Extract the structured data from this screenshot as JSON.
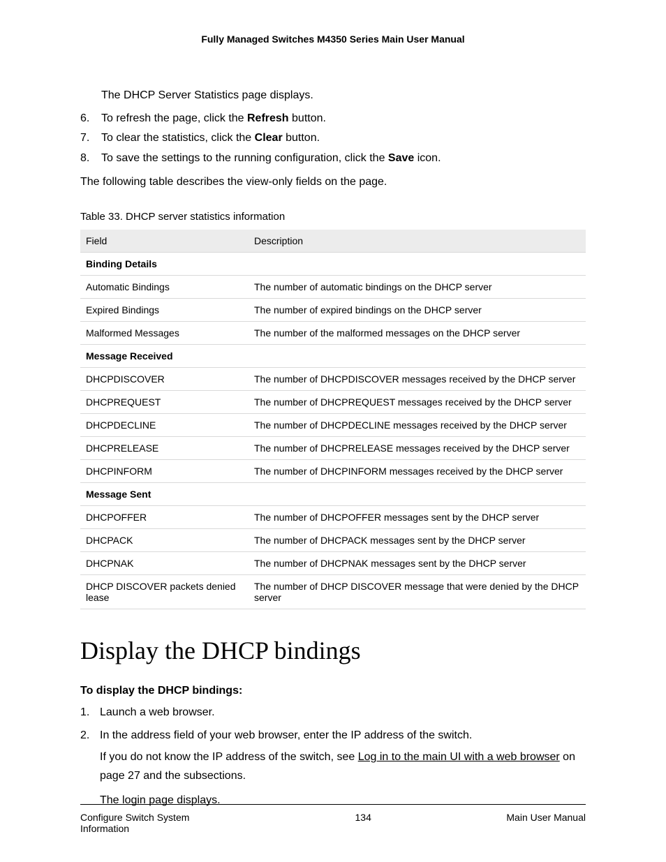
{
  "header": {
    "title": "Fully Managed Switches M4350 Series Main User Manual"
  },
  "body": {
    "p_intro": "The DHCP Server Statistics page displays.",
    "step6": {
      "num": "6.",
      "pre": "To refresh the page, click the ",
      "bold": "Refresh",
      "post": " button."
    },
    "step7": {
      "num": "7.",
      "pre": "To clear the statistics, click the ",
      "bold": "Clear",
      "post": " button."
    },
    "step8": {
      "num": "8.",
      "pre": "To save the settings to the running configuration, click the ",
      "bold": "Save",
      "post": " icon."
    },
    "p_tabledesc": "The following table describes the view-only fields on the page.",
    "table_caption": "Table 33. DHCP server statistics information",
    "th_field": "Field",
    "th_desc": "Description"
  },
  "table_rows": [
    {
      "section": true,
      "field": "Binding Details",
      "desc": ""
    },
    {
      "field": "Automatic Bindings",
      "desc": "The number of automatic bindings on the DHCP server"
    },
    {
      "field": "Expired Bindings",
      "desc": "The number of expired bindings on the DHCP server"
    },
    {
      "field": "Malformed Messages",
      "desc": "The number of the malformed messages on the DHCP server"
    },
    {
      "section": true,
      "field": "Message Received",
      "desc": ""
    },
    {
      "field": "DHCPDISCOVER",
      "desc": "The number of DHCPDISCOVER messages received by the DHCP server"
    },
    {
      "field": "DHCPREQUEST",
      "desc": "The number of DHCPREQUEST messages received by the DHCP server"
    },
    {
      "field": "DHCPDECLINE",
      "desc": "The number of DHCPDECLINE messages received by the DHCP server"
    },
    {
      "field": "DHCPRELEASE",
      "desc": "The number of DHCPRELEASE messages received by the DHCP server"
    },
    {
      "field": "DHCPINFORM",
      "desc": "The number of DHCPINFORM messages received by the DHCP server"
    },
    {
      "section": true,
      "field": "Message Sent",
      "desc": ""
    },
    {
      "field": "DHCPOFFER",
      "desc": "The number of DHCPOFFER messages sent by the DHCP server"
    },
    {
      "field": "DHCPACK",
      "desc": "The number of DHCPACK messages sent by the DHCP server"
    },
    {
      "field": "DHCPNAK",
      "desc": "The number of DHCPNAK messages sent by the DHCP server"
    },
    {
      "field": "DHCP DISCOVER packets denied lease",
      "desc": "The number of DHCP DISCOVER message that were denied by the DHCP server"
    }
  ],
  "section2": {
    "title": "Display the DHCP bindings",
    "lead": "To display the DHCP bindings:",
    "step1": {
      "num": "1.",
      "text": "Launch a web browser."
    },
    "step2": {
      "num": "2.",
      "text": "In the address field of your web browser, enter the IP address of the switch."
    },
    "step2_cont_pre": "If you do not know the IP address of the switch, see ",
    "step2_link": "Log in to the main UI with a web browser",
    "step2_cont_post": " on page 27 and the subsections.",
    "step2_final": "The login page displays."
  },
  "footer": {
    "left": "Configure Switch System Information",
    "center": "134",
    "right": "Main User Manual"
  }
}
